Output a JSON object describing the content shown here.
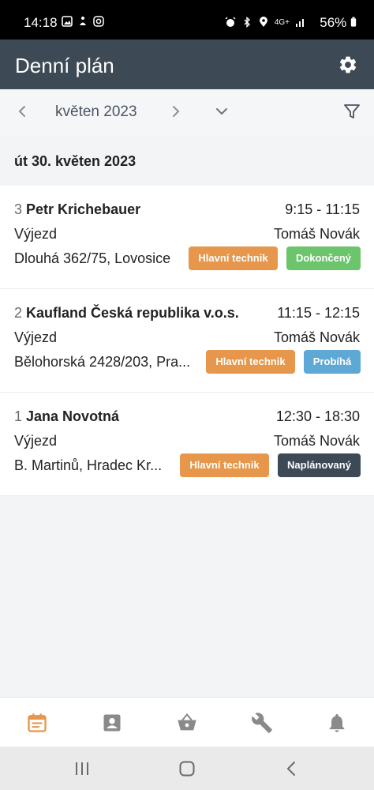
{
  "status_bar": {
    "time": "14:18",
    "battery": "56%",
    "network": "4G+",
    "icons_left": [
      "image-icon",
      "accessibility-icon",
      "instagram-icon"
    ],
    "icons_right": [
      "alarm-icon",
      "bluetooth-icon",
      "location-icon",
      "signal-icon",
      "battery-icon"
    ]
  },
  "header": {
    "title": "Denní plán",
    "settings_icon": "gear-icon",
    "background": "#3d4a56"
  },
  "date_nav": {
    "month": "květen 2023",
    "prev_icon": "chevron-left-icon",
    "next_icon": "chevron-right-icon",
    "dropdown_icon": "chevron-down-icon",
    "filter_icon": "filter-icon"
  },
  "day": {
    "label": "út 30. květen 2023"
  },
  "appointments": [
    {
      "number": "3",
      "name": "Petr Krichebauer",
      "time": "9:15 - 11:15",
      "type": "Výjezd",
      "technician": "Tomáš Novák",
      "address": "Dlouhá 362/75, Lovosice",
      "role_badge": "Hlavní technik",
      "status_badge": "Dokončený",
      "status_color": "#6cc46c"
    },
    {
      "number": "2",
      "name": "Kaufland Česká republika v.o.s.",
      "time": "11:15 - 12:15",
      "type": "Výjezd",
      "technician": "Tomáš Novák",
      "address": "Bělohorská 2428/203, Pra...",
      "role_badge": "Hlavní technik",
      "status_badge": "Probíhá",
      "status_color": "#5ea8d6"
    },
    {
      "number": "1",
      "name": "Jana Novotná",
      "time": "12:30 - 18:30",
      "type": "Výjezd",
      "technician": "Tomáš Novák",
      "address": "B. Martinů, Hradec Kr...",
      "role_badge": "Hlavní technik",
      "status_badge": "Naplánovaný",
      "status_color": "#3d4a56"
    }
  ],
  "colors": {
    "role_badge": "#e6974b",
    "active_tab": "#e6974b",
    "inactive_tab": "#8a8a8a"
  },
  "bottom_nav": {
    "tabs": [
      "calendar-icon",
      "contact-icon",
      "basket-icon",
      "wrench-icon",
      "bell-icon"
    ],
    "active_tab": "calendar-icon"
  },
  "android_nav": {
    "buttons": [
      "recents-icon",
      "home-icon",
      "back-icon"
    ]
  }
}
